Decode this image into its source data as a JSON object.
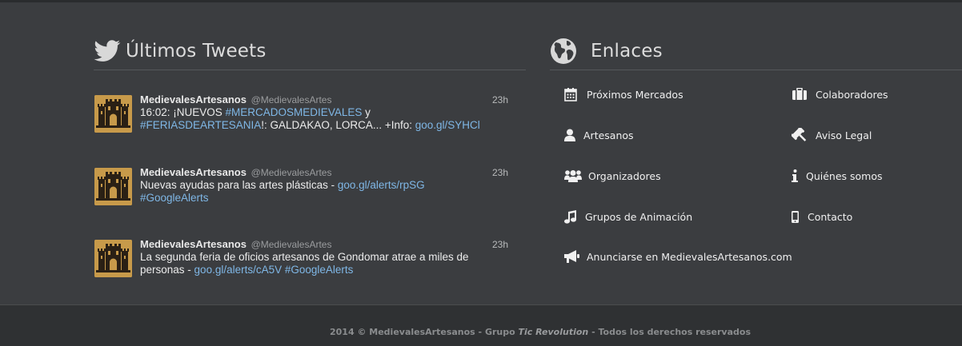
{
  "tweets_section": {
    "title": "Últimos Tweets",
    "tweets": [
      {
        "name": "MedievalesArtesanos",
        "handle": "@MedievalesArtes",
        "time": "23h",
        "line1_plain": "16:02: ¡NUEVOS ",
        "line1_tag": "#MERCADOSMEDIEVALES",
        "line1_end": " y",
        "line2_tag": "#FERIASDEARTESANIA",
        "line2_plain": "!: GALDAKAO, LORCA... +Info: ",
        "line2_link": "goo.gl/SYHCl"
      },
      {
        "name": "MedievalesArtesanos",
        "handle": "@MedievalesArtes",
        "time": "23h",
        "line1_plain": "Nuevas ayudas para las artes plásticas - ",
        "line1_link": "goo.gl/alerts/rpSG",
        "line2_tag": "#GoogleAlerts"
      },
      {
        "name": "MedievalesArtesanos",
        "handle": "@MedievalesArtes",
        "time": "23h",
        "line1_plain": "La segunda feria de oficios artesanos de Gondomar atrae a miles de",
        "line2_plain": "personas - ",
        "line2_link": "goo.gl/alerts/cA5V",
        "line2_tag": "#GoogleAlerts"
      }
    ]
  },
  "links_section": {
    "title": "Enlaces",
    "items": [
      {
        "label": "Próximos Mercados",
        "icon": "calendar-icon"
      },
      {
        "label": "Colaboradores",
        "icon": "briefcase-icon"
      },
      {
        "label": "Artesanos",
        "icon": "user-icon"
      },
      {
        "label": "Aviso Legal",
        "icon": "gavel-icon"
      },
      {
        "label": "Organizadores",
        "icon": "users-icon"
      },
      {
        "label": "Quiénes somos",
        "icon": "info-icon"
      },
      {
        "label": "Grupos de Animación",
        "icon": "music-icon"
      },
      {
        "label": "Contacto",
        "icon": "mobile-icon"
      },
      {
        "label": "Anunciarse en MedievalesArtesanos.com",
        "icon": "bullhorn-icon"
      }
    ]
  },
  "footer": {
    "prefix": "2014 © MedievalesArtesanos - Grupo ",
    "company": "Tic Revolution",
    "suffix": " - Todos los derechos reservados"
  },
  "colors": {
    "background": "#3b3d40",
    "footer": "#2f3133",
    "link": "#7fb7e6",
    "avatar": "#c79a4a"
  }
}
